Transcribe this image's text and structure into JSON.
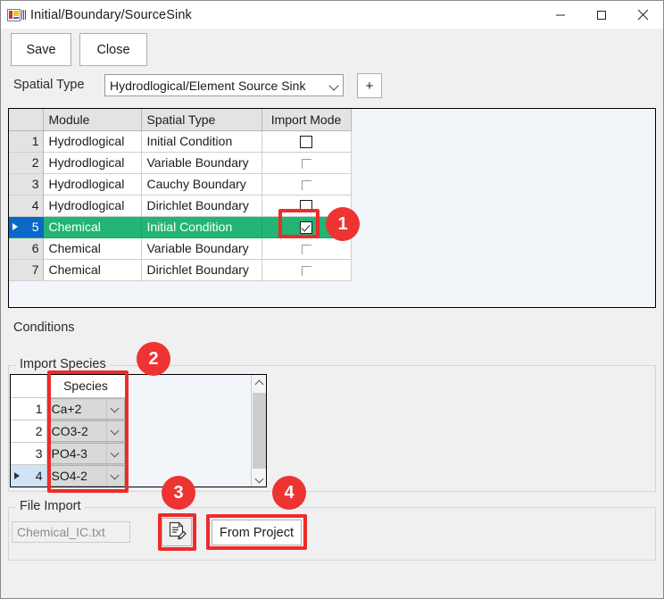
{
  "window": {
    "title": "Initial/Boundary/SourceSink",
    "icon": "winforms-app-icon",
    "minimize_label": "minimize-icon",
    "maximize_label": "maximize-icon",
    "close_label": "close-icon"
  },
  "toolbar": {
    "save_label": "Save",
    "close_label": "Close"
  },
  "spatial_type": {
    "label": "Spatial Type",
    "selected": "Hydrodlogical/Element Source Sink",
    "add_label": "+"
  },
  "main_grid": {
    "columns": [
      "",
      "Module",
      "Spatial Type",
      "Import Mode"
    ],
    "rows": [
      {
        "num": "1",
        "module": "Hydrodlogical",
        "spatial_type": "Initial Condition",
        "import_mode": "unchecked",
        "selected": false
      },
      {
        "num": "2",
        "module": "Hydrodlogical",
        "spatial_type": "Variable Boundary",
        "import_mode": "partial",
        "selected": false
      },
      {
        "num": "3",
        "module": "Hydrodlogical",
        "spatial_type": "Cauchy Boundary",
        "import_mode": "partial",
        "selected": false
      },
      {
        "num": "4",
        "module": "Hydrodlogical",
        "spatial_type": "Dirichlet Boundary",
        "import_mode": "unchecked",
        "selected": false
      },
      {
        "num": "5",
        "module": "Chemical",
        "spatial_type": "Initial Condition",
        "import_mode": "checked",
        "selected": true
      },
      {
        "num": "6",
        "module": "Chemical",
        "spatial_type": "Variable Boundary",
        "import_mode": "partial",
        "selected": false
      },
      {
        "num": "7",
        "module": "Chemical",
        "spatial_type": "Dirichlet Boundary",
        "import_mode": "partial",
        "selected": false
      }
    ]
  },
  "conditions": {
    "label": "Conditions"
  },
  "import_species": {
    "label": "Import Species",
    "column_header": "Species",
    "rows": [
      {
        "num": "1",
        "species": "Ca+2",
        "selected": false
      },
      {
        "num": "2",
        "species": "CO3-2",
        "selected": false
      },
      {
        "num": "3",
        "species": "PO4-3",
        "selected": false
      },
      {
        "num": "4",
        "species": "SO4-2",
        "selected": true
      },
      {
        "num": "",
        "species": "",
        "selected": false
      }
    ],
    "scroll_up": "scroll-up-icon",
    "scroll_down": "scroll-down-icon"
  },
  "file_import": {
    "label": "File Import",
    "filename": "Chemical_IC.txt",
    "edit_icon": "document-edit-icon",
    "from_project_label": "From Project"
  },
  "annotations": [
    {
      "id": "1",
      "target": "import-mode-checkbox-row5"
    },
    {
      "id": "2",
      "target": "species-column"
    },
    {
      "id": "3",
      "target": "file-edit-button"
    },
    {
      "id": "4",
      "target": "from-project-button"
    }
  ],
  "colors": {
    "selected_row": "#22b573",
    "row_header_selected": "#0c68c7",
    "annotation": "#ee3333",
    "window_chrome": "#f0f0f0",
    "grid_background": "#f2f5fa"
  }
}
